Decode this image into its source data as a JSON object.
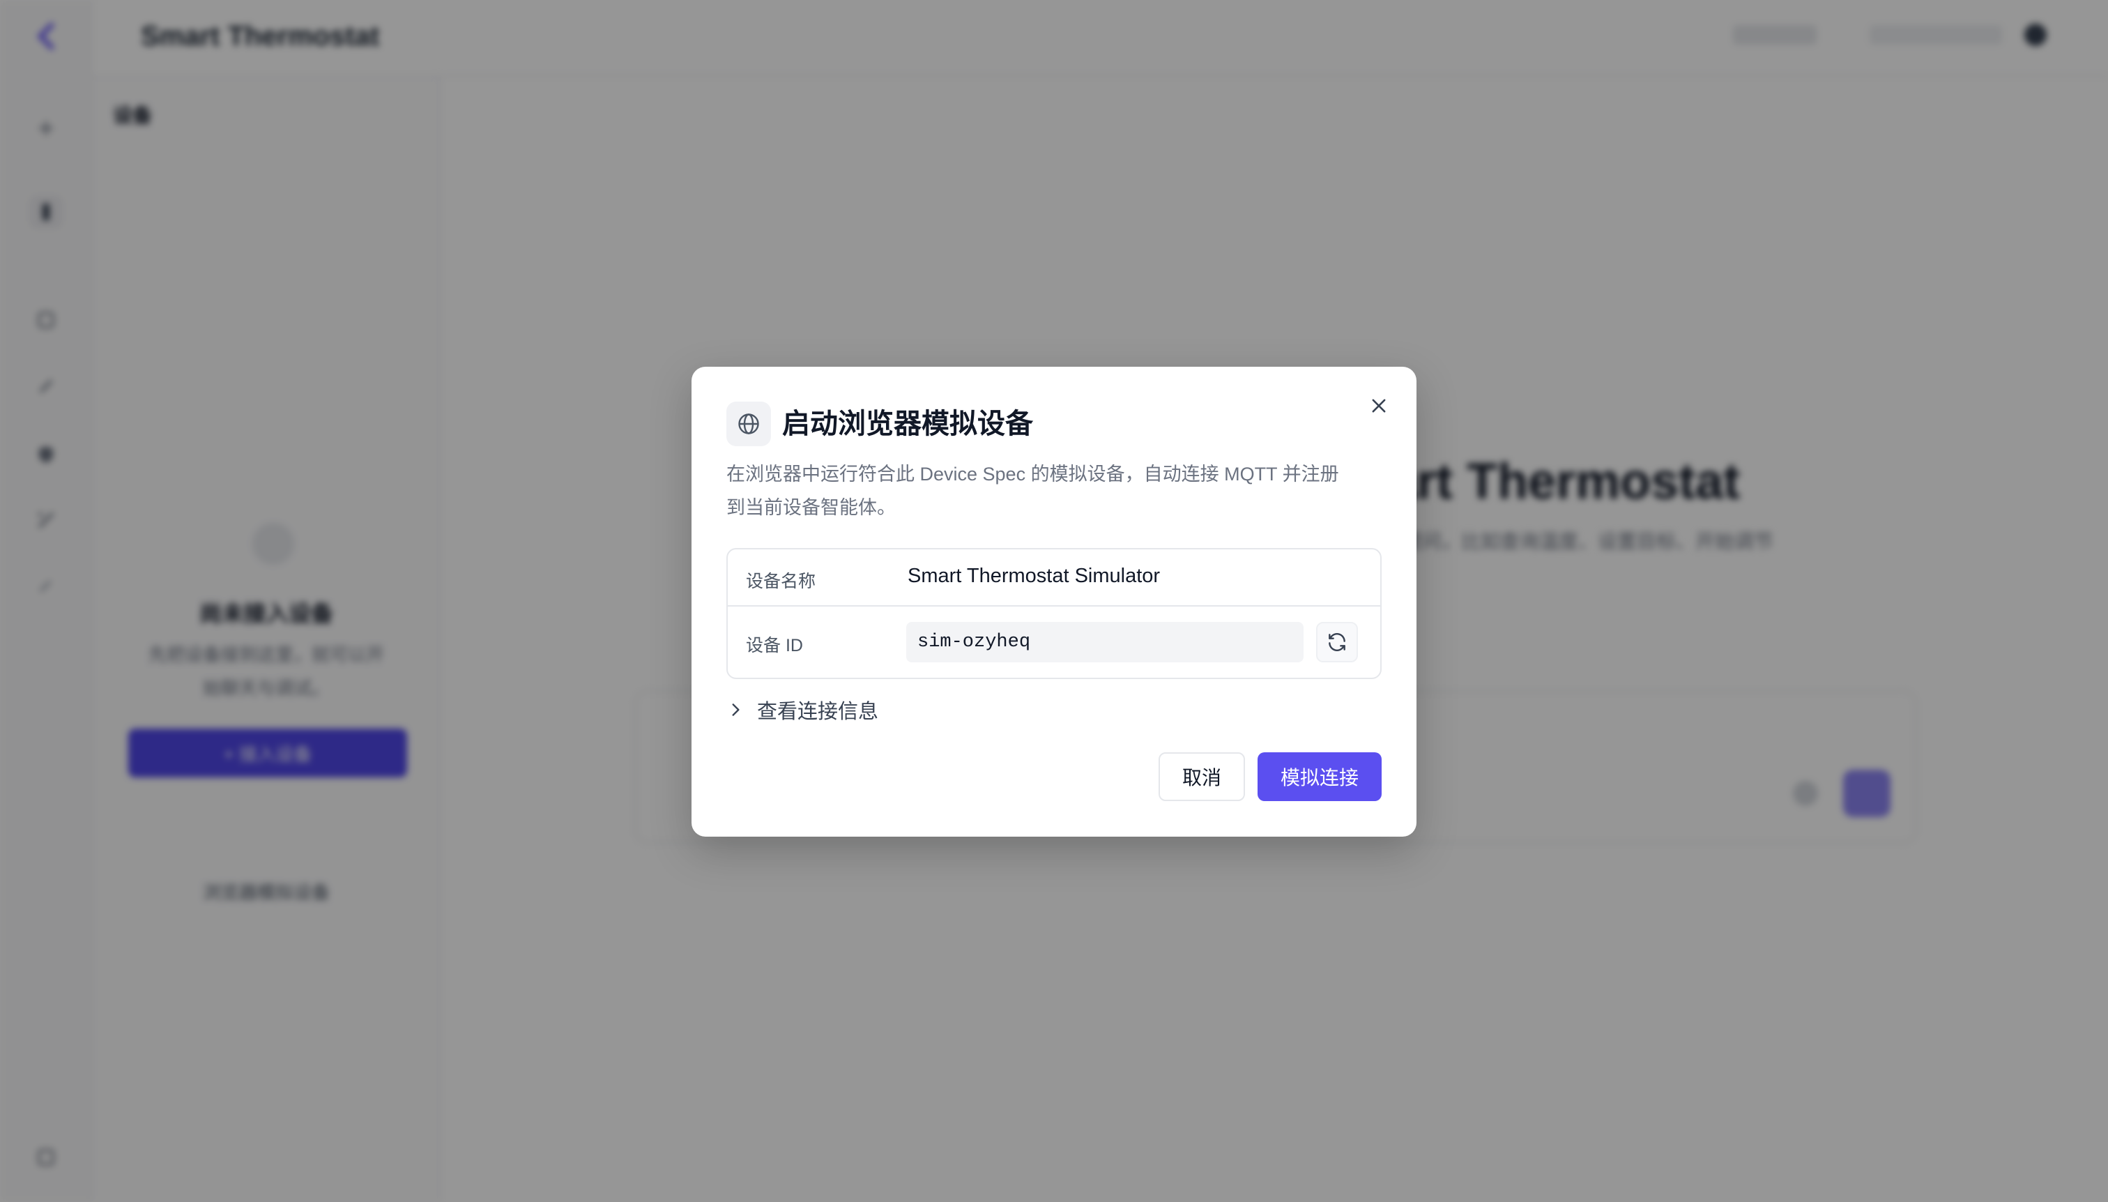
{
  "background": {
    "app_title": "Smart Thermostat",
    "sidebar_tab": "设备",
    "empty_title": "尚未接入设备",
    "empty_desc": "先把设备接到这里，就可以开始聊天与调试。",
    "add_device_label": "+ 接入设备",
    "sim_link_label": "浏览器模拟设备",
    "main_title": "Smart Thermostat",
    "main_subtitle": "向智能体提问，比如查询温度、设置目标、开始调节"
  },
  "modal": {
    "title": "启动浏览器模拟设备",
    "description": "在浏览器中运行符合此 Device Spec 的模拟设备，自动连接 MQTT 并注册到当前设备智能体。",
    "device_name_label": "设备名称",
    "device_name_value": "Smart Thermostat Simulator",
    "device_id_label": "设备 ID",
    "device_id_value": "sim-ozyheq",
    "connection_info_label": "查看连接信息",
    "cancel_label": "取消",
    "connect_label": "模拟连接"
  },
  "icons": {
    "title_icon": "globe-icon",
    "close": "close-icon",
    "refresh": "refresh-icon",
    "chevron": "chevron-right-icon"
  },
  "colors": {
    "primary": "#5b4ff0",
    "overlay": "rgba(0,0,0,0.41)"
  }
}
